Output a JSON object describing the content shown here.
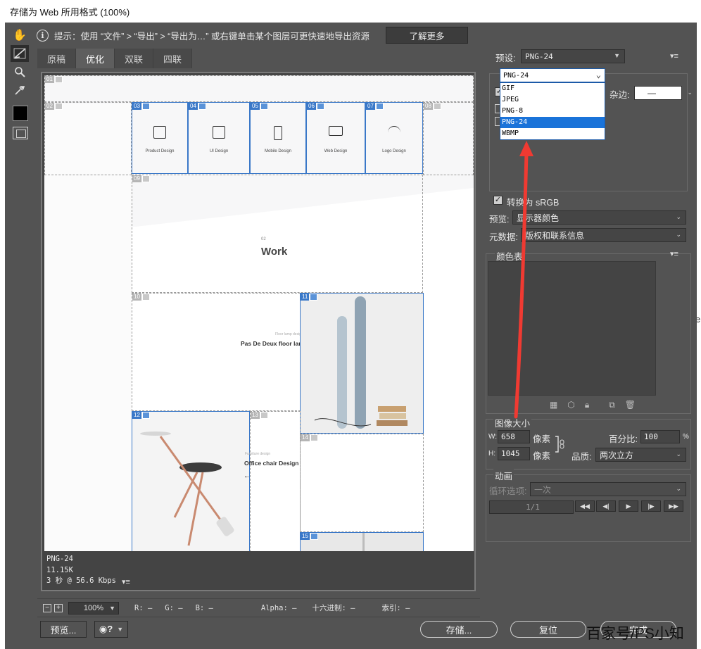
{
  "window": {
    "title": "存储为 Web 所用格式 (100%)"
  },
  "hint": {
    "text": "提示：使用 “文件” > “导出” > “导出为…” 或右键单击某个图层可更快速地导出资源",
    "learn_more": "了解更多"
  },
  "tools": [
    "hand-icon",
    "slice-select-icon",
    "zoom-icon",
    "eyedropper-icon"
  ],
  "tabs": [
    {
      "label": "原稿",
      "active": false
    },
    {
      "label": "优化",
      "active": true
    },
    {
      "label": "双联",
      "active": false
    },
    {
      "label": "四联",
      "active": false
    }
  ],
  "canvas": {
    "slices": [
      "01",
      "02",
      "03",
      "04",
      "05",
      "06",
      "07",
      "08",
      "09",
      "10",
      "11",
      "12",
      "13",
      "14",
      "15"
    ],
    "cards": [
      "Product Design",
      "UI Design",
      "Mobile Design",
      "Web Design",
      "Logo Design"
    ],
    "work_small": "02",
    "work": "Work",
    "lamp_sub": "Floor lamp design",
    "lamp_title": "Pas De Deux floor lamp",
    "chair_sub": "Furniture design",
    "chair_title": "Office chair Design",
    "arrow_right": "→",
    "arrow_left": "←"
  },
  "optimized_info": {
    "format": "PNG-24",
    "size": "11.15K",
    "time": "3 秒 @ 56.6 Kbps"
  },
  "statusbar": {
    "zoom": "100%",
    "r": "R: —",
    "g": "G: —",
    "b": "B: —",
    "alpha": "Alpha: —",
    "hex": "十六进制: —",
    "index": "索引: —"
  },
  "buttons": {
    "preview": "预览...",
    "save": "存储...",
    "reset": "复位",
    "done": "完成"
  },
  "right_panel": {
    "preset_label": "预设:",
    "preset_value": "PNG-24",
    "matte_label": "杂边:",
    "matte_value": "—",
    "convert_srgb": "转换为 sRGB",
    "preview_label": "预览:",
    "preview_value": "显示器颜色",
    "metadata_label": "元数据:",
    "metadata_value": "版权和联系信息",
    "color_table_label": "颜色表",
    "image_size_label": "图像大小",
    "w_label": "W:",
    "w_value": "658",
    "h_label": "H:",
    "h_value": "1045",
    "px_unit": "像素",
    "percent_label": "百分比:",
    "percent_value": "100",
    "percent_sign": "%",
    "quality_label": "品质:",
    "quality_value": "两次立方",
    "animation_label": "动画",
    "loop_label": "循环选项:",
    "loop_value": "一次",
    "frame_counter": "1/1"
  },
  "format_dropdown": {
    "selected": "PNG-24",
    "options": [
      "GIF",
      "JPEG",
      "PNG-8",
      "PNG-24",
      "WBMP"
    ],
    "highlighted_index": 3
  },
  "watermark": "百家号/PS小知",
  "edge_char": "e",
  "colors": {
    "dialog_bg": "#535353",
    "selection_blue": "#1a73d9",
    "slice_blue": "#3a78c8",
    "annotation_red": "#f03a32"
  }
}
